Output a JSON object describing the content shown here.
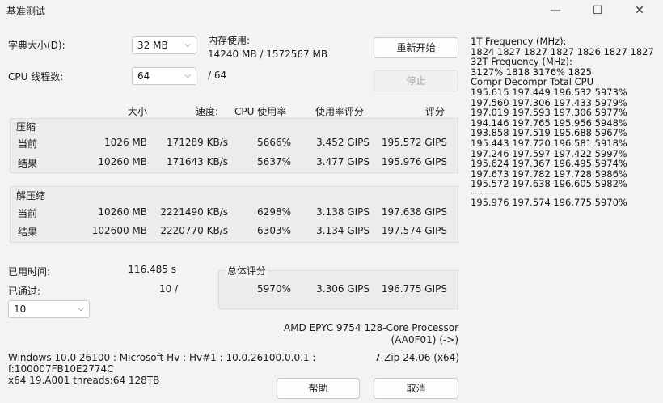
{
  "window": {
    "title": "基准测试",
    "minimize": "—",
    "maximize": "☐",
    "close": "✕"
  },
  "dictionary": {
    "label": "字典大小(D):",
    "value": "32 MB"
  },
  "threads": {
    "label": "CPU 线程数:",
    "value": "64",
    "total": "/ 64"
  },
  "memory": {
    "label": "内存使用:",
    "value": "14240 MB / 1572567 MB"
  },
  "buttons": {
    "restart": "重新开始",
    "stop": "停止",
    "help": "帮助",
    "cancel": "取消"
  },
  "headers": {
    "size": "大小",
    "speed": "速度:",
    "cpu": "CPU 使用率",
    "rating_usage": "使用率评分",
    "rating": "评分"
  },
  "compress": {
    "title": "压缩",
    "current": {
      "label": "当前",
      "size": "1026 MB",
      "speed": "171289 KB/s",
      "cpu": "5666%",
      "rating_usage": "3.452 GIPS",
      "rating": "195.572 GIPS"
    },
    "result": {
      "label": "结果",
      "size": "10260 MB",
      "speed": "171643 KB/s",
      "cpu": "5637%",
      "rating_usage": "3.477 GIPS",
      "rating": "195.976 GIPS"
    }
  },
  "decompress": {
    "title": "解压缩",
    "current": {
      "label": "当前",
      "size": "10260 MB",
      "speed": "2221490 KB/s",
      "cpu": "6298%",
      "rating_usage": "3.138 GIPS",
      "rating": "197.638 GIPS"
    },
    "result": {
      "label": "结果",
      "size": "102600 MB",
      "speed": "2220770 KB/s",
      "cpu": "6303%",
      "rating_usage": "3.134 GIPS",
      "rating": "197.574 GIPS"
    }
  },
  "elapsed": {
    "label": "已用时间:",
    "value": "116.485 s"
  },
  "passes": {
    "label": "已通过:",
    "value": "10 /",
    "select_value": "10"
  },
  "total": {
    "title": "总体评分",
    "cpu": "5970%",
    "rating_usage": "3.306 GIPS",
    "rating": "196.775 GIPS"
  },
  "cpu_info": {
    "line1": "AMD EPYC 9754 128-Core Processor",
    "line2": "(AA0F01) (->)"
  },
  "sys_info": {
    "line1": "Windows 10.0 26100 : Microsoft Hv : Hv#1 : 10.0.26100.0.0.1 :",
    "line2": "f:100007FB10E2774C",
    "line3": "x64 19.A001 threads:64 128TB"
  },
  "version": "7-Zip 24.06 (x64)",
  "freq": {
    "lines": [
      "1T Frequency (MHz):",
      " 1824 1827 1827 1827 1826 1827 1827",
      "32T Frequency (MHz):",
      " 3127% 1818 3176% 1825",
      "Compr Decompr Total  CPU",
      "195.615  197.449  196.532  5973%",
      "197.560  197.306  197.433  5979%",
      "197.019  197.593  197.306  5977%",
      "194.146  197.765  195.956  5948%",
      "193.858  197.519  195.688  5967%",
      "195.443  197.720  196.581  5918%",
      "197.246  197.597  197.422  5997%",
      "195.624  197.367  196.495  5974%",
      "197.673  197.782  197.728  5986%",
      "195.572  197.638  196.605  5982%",
      "------------",
      "195.976  197.574  196.775  5970%"
    ]
  }
}
